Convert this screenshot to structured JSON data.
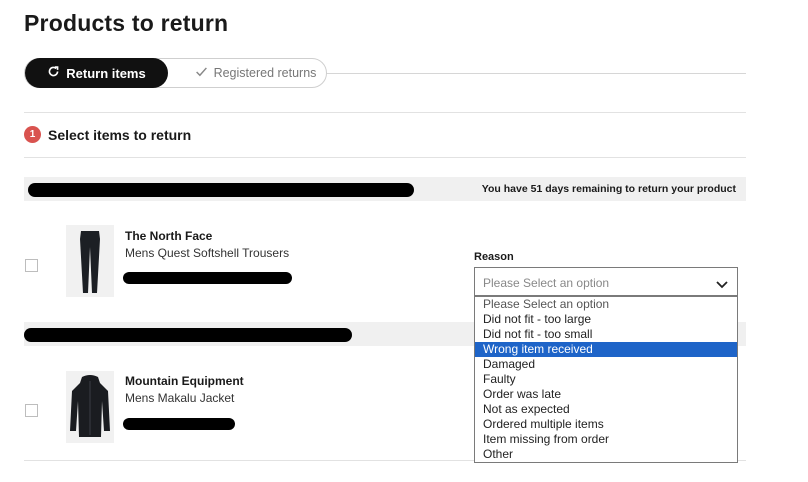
{
  "page": {
    "title": "Products to return"
  },
  "tabs": {
    "active_label": "Return items",
    "inactive_label": "Registered returns"
  },
  "step": {
    "number": "1",
    "label": "Select items to return"
  },
  "order": {
    "days_remaining": "You have 51 days remaining to return your product"
  },
  "products": [
    {
      "brand": "The North Face",
      "name": "Mens Quest Softshell Trousers"
    },
    {
      "brand": "Mountain Equipment",
      "name": "Mens Makalu Jacket"
    }
  ],
  "reason": {
    "label": "Reason",
    "selected": "Please Select an option",
    "options": [
      "Please Select an option",
      "Did not fit - too large",
      "Did not fit - too small",
      "Wrong item received",
      "Damaged",
      "Faulty",
      "Order was late",
      "Not as expected",
      "Ordered multiple items",
      "Item missing from order",
      "Other"
    ],
    "highlighted_index": 3
  },
  "colors": {
    "accent": "#d9534f",
    "highlight": "#1e64c8",
    "dark": "#111111"
  },
  "icons": {
    "return_tab": "refresh-icon",
    "registered_tab": "check-icon",
    "select": "chevron-down-icon"
  }
}
